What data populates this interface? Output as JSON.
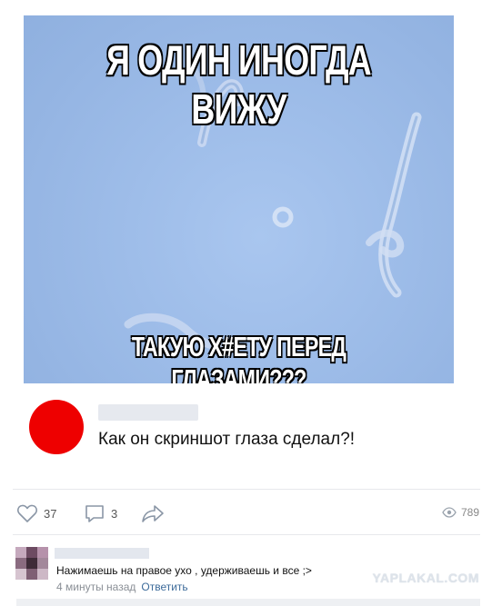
{
  "meme": {
    "top_caption": "Я ОДИН ИНОГДА ВИЖУ",
    "bottom_caption": "ТАКУЮ Х#ЕТУ ПЕРЕД ГЛАЗАМИ???"
  },
  "post": {
    "avatar_color": "#ee0000",
    "text": "Как он скриншот глаза сделал?!"
  },
  "actions": {
    "likes": "37",
    "comments": "3",
    "views": "789"
  },
  "comment": {
    "text": "Нажимаешь на правое ухо , удерживаешь и все ;>",
    "time": "4 минуты назад",
    "reply_label": "Ответить"
  },
  "watermark": "YAPLAKAL.COM"
}
